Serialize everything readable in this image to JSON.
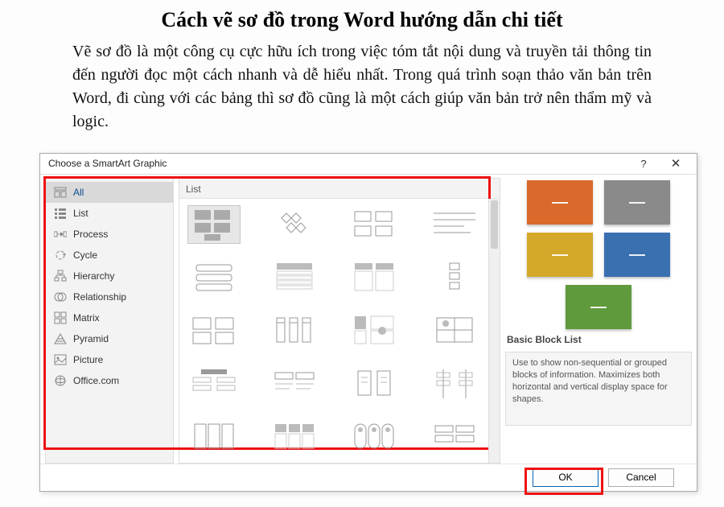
{
  "article": {
    "title": "Cách vẽ sơ đồ trong Word hướng dẫn chi tiết",
    "paragraph": "Vẽ sơ đồ là một công cụ cực hữu ích trong việc tóm tắt nội dung và truyền tải thông tin đến người đọc một cách nhanh và dễ hiểu nhất. Trong quá trình soạn thảo văn bản trên Word, đi cùng với các bảng thì sơ đồ cũng là một cách giúp văn bản trở nên thẩm mỹ và logic."
  },
  "dialog": {
    "title": "Choose a SmartArt Graphic",
    "help": "?",
    "close": "✕"
  },
  "sidebar": {
    "items": [
      {
        "label": "All",
        "icon": "all-icon",
        "selected": true
      },
      {
        "label": "List",
        "icon": "list-icon",
        "selected": false
      },
      {
        "label": "Process",
        "icon": "process-icon",
        "selected": false
      },
      {
        "label": "Cycle",
        "icon": "cycle-icon",
        "selected": false
      },
      {
        "label": "Hierarchy",
        "icon": "hierarchy-icon",
        "selected": false
      },
      {
        "label": "Relationship",
        "icon": "relationship-icon",
        "selected": false
      },
      {
        "label": "Matrix",
        "icon": "matrix-icon",
        "selected": false
      },
      {
        "label": "Pyramid",
        "icon": "pyramid-icon",
        "selected": false
      },
      {
        "label": "Picture",
        "icon": "picture-icon",
        "selected": false
      },
      {
        "label": "Office.com",
        "icon": "office-icon",
        "selected": false
      }
    ]
  },
  "gallery": {
    "header": "List"
  },
  "preview": {
    "title": "Basic Block List",
    "description": "Use to show non-sequential or grouped blocks of information. Maximizes both horizontal and vertical display space for shapes.",
    "blocks": [
      {
        "color": "#d96a2b"
      },
      {
        "color": "#8a8a8a"
      },
      {
        "color": "#d4a929"
      },
      {
        "color": "#3a6fb0"
      },
      {
        "color": "#5f9a3c"
      }
    ]
  },
  "footer": {
    "ok": "OK",
    "cancel": "Cancel"
  }
}
